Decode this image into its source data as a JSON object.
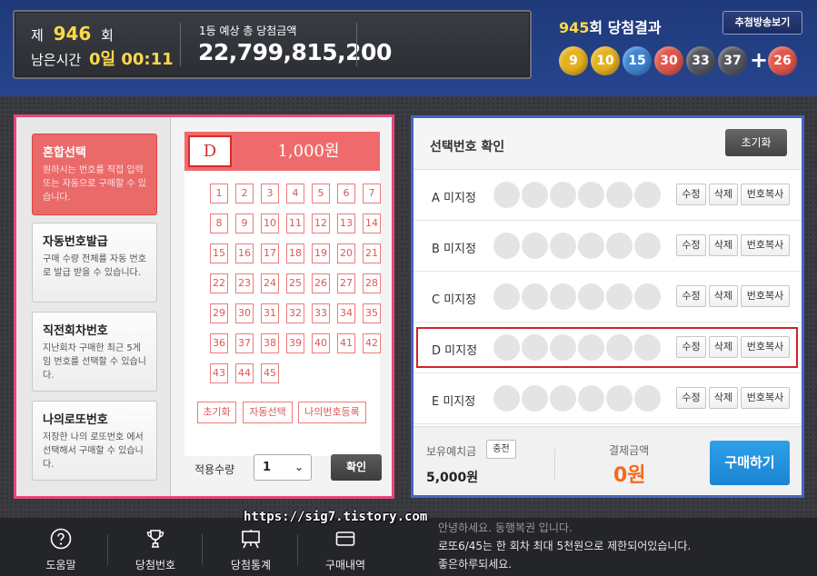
{
  "header": {
    "round_prefix": "제",
    "round_number": "946",
    "round_suffix": "회",
    "time_left_label": "남은시간",
    "time_left": "0일 00:11",
    "prize_label": "1등 예상 총 당첨금액",
    "prize_amount": "22,799,815,200",
    "last_round": "945",
    "last_round_title": "회 당첨결과",
    "broadcast_button": "추첨방송보기",
    "winning_numbers": [
      {
        "n": "9",
        "color": "#e6b21e"
      },
      {
        "n": "10",
        "color": "#e6b21e"
      },
      {
        "n": "15",
        "color": "#3f86d6"
      },
      {
        "n": "30",
        "color": "#e2574c"
      },
      {
        "n": "33",
        "color": "#555760"
      },
      {
        "n": "37",
        "color": "#555760"
      }
    ],
    "bonus_number": {
      "n": "26",
      "color": "#e2574c"
    },
    "plus_sign": "+"
  },
  "modes": [
    {
      "title": "혼합선택",
      "desc": "원하시는 번호를 직접 입력 또는 자동으로 구매할 수 있습니다."
    },
    {
      "title": "자동번호발급",
      "desc": "구매 수량 전체를 자동 번호로 발급 받을 수 있습니다."
    },
    {
      "title": "직전회차번호",
      "desc": "지난회차 구매한 최근 5게임 번호를 선택할 수 있습니다."
    },
    {
      "title": "나의로또번호",
      "desc": "저장한 나의 로또번호 에서 선택해서 구매할 수 있습니다."
    }
  ],
  "slip": {
    "game_letter": "D",
    "price": "1,000원",
    "numbers": [
      "1",
      "2",
      "3",
      "4",
      "5",
      "6",
      "7",
      "8",
      "9",
      "10",
      "11",
      "12",
      "13",
      "14",
      "15",
      "16",
      "17",
      "18",
      "19",
      "20",
      "21",
      "22",
      "23",
      "24",
      "25",
      "26",
      "27",
      "28",
      "29",
      "30",
      "31",
      "32",
      "33",
      "34",
      "35",
      "36",
      "37",
      "38",
      "39",
      "40",
      "41",
      "42",
      "43",
      "44",
      "45"
    ],
    "reset": "초기화",
    "auto": "자동선택",
    "my_register": "나의번호등록"
  },
  "quantity": {
    "label": "적용수량",
    "value": "1",
    "confirm": "확인"
  },
  "selection": {
    "title": "선택번호 확인",
    "reset": "초기화",
    "rows": [
      {
        "label": "A 미지정"
      },
      {
        "label": "B 미지정"
      },
      {
        "label": "C 미지정"
      },
      {
        "label": "D 미지정"
      },
      {
        "label": "E 미지정"
      }
    ],
    "edit": "수정",
    "delete": "삭제",
    "copy": "번호복사"
  },
  "payment": {
    "balance_label": "보유예치금",
    "charge": "충전",
    "balance": "5,000원",
    "pay_label": "결제금액",
    "pay_amount": "0원",
    "buy": "구매하기"
  },
  "footer": {
    "items": [
      "도움말",
      "당첨번호",
      "당첨통계",
      "구매내역"
    ],
    "notice_lines": [
      "안녕하세요. 동행복권 입니다.",
      "로또6/45는 한 회차 최대 5천원으로 제한되어있습니다.",
      "좋은하루되세요."
    ]
  },
  "watermark": "https://sig7.tistory.com"
}
